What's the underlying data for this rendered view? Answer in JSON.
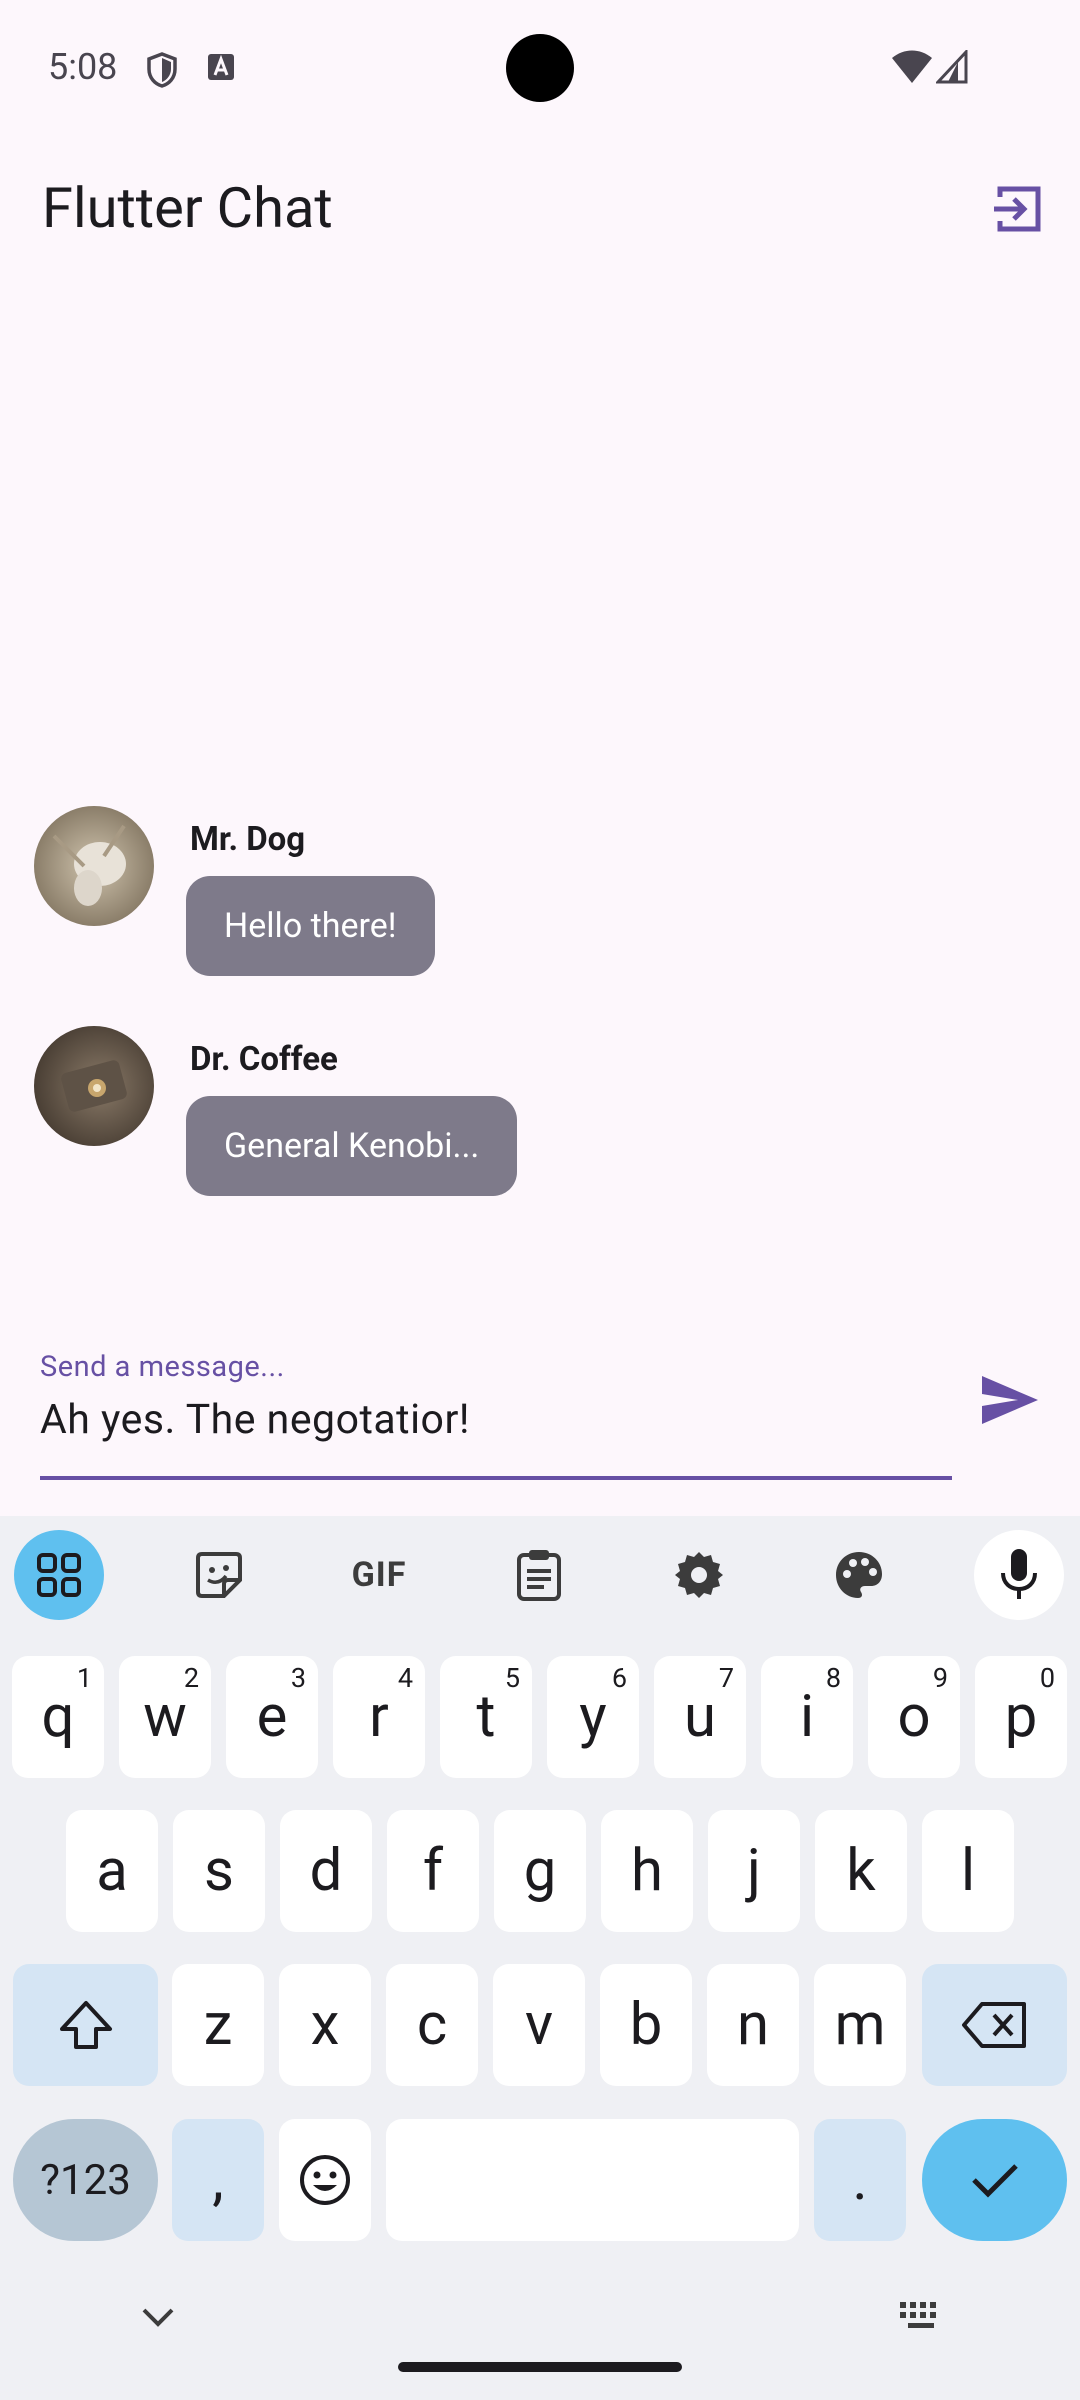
{
  "status_bar": {
    "time": "5:08"
  },
  "app_bar": {
    "title": "Flutter Chat"
  },
  "messages": [
    {
      "sender": "Mr. Dog",
      "text": "Hello there!"
    },
    {
      "sender": "Dr. Coffee",
      "text": "General Kenobi..."
    }
  ],
  "composer": {
    "label": "Send a message...",
    "value": "Ah yes. The negotatior!"
  },
  "keyboard": {
    "row1": [
      {
        "key": "q",
        "num": "1"
      },
      {
        "key": "w",
        "num": "2"
      },
      {
        "key": "e",
        "num": "3"
      },
      {
        "key": "r",
        "num": "4"
      },
      {
        "key": "t",
        "num": "5"
      },
      {
        "key": "y",
        "num": "6"
      },
      {
        "key": "u",
        "num": "7"
      },
      {
        "key": "i",
        "num": "8"
      },
      {
        "key": "o",
        "num": "9"
      },
      {
        "key": "p",
        "num": "0"
      }
    ],
    "row2": [
      "a",
      "s",
      "d",
      "f",
      "g",
      "h",
      "j",
      "k",
      "l"
    ],
    "row3": [
      "z",
      "x",
      "c",
      "v",
      "b",
      "n",
      "m"
    ],
    "sym_label": "?123",
    "comma": ",",
    "period": ".",
    "toolbar_gif": "GIF"
  },
  "colors": {
    "accent": "#6750a4",
    "bubble": "#7e7a8a",
    "keyboard_accent": "#5fc0ef"
  }
}
